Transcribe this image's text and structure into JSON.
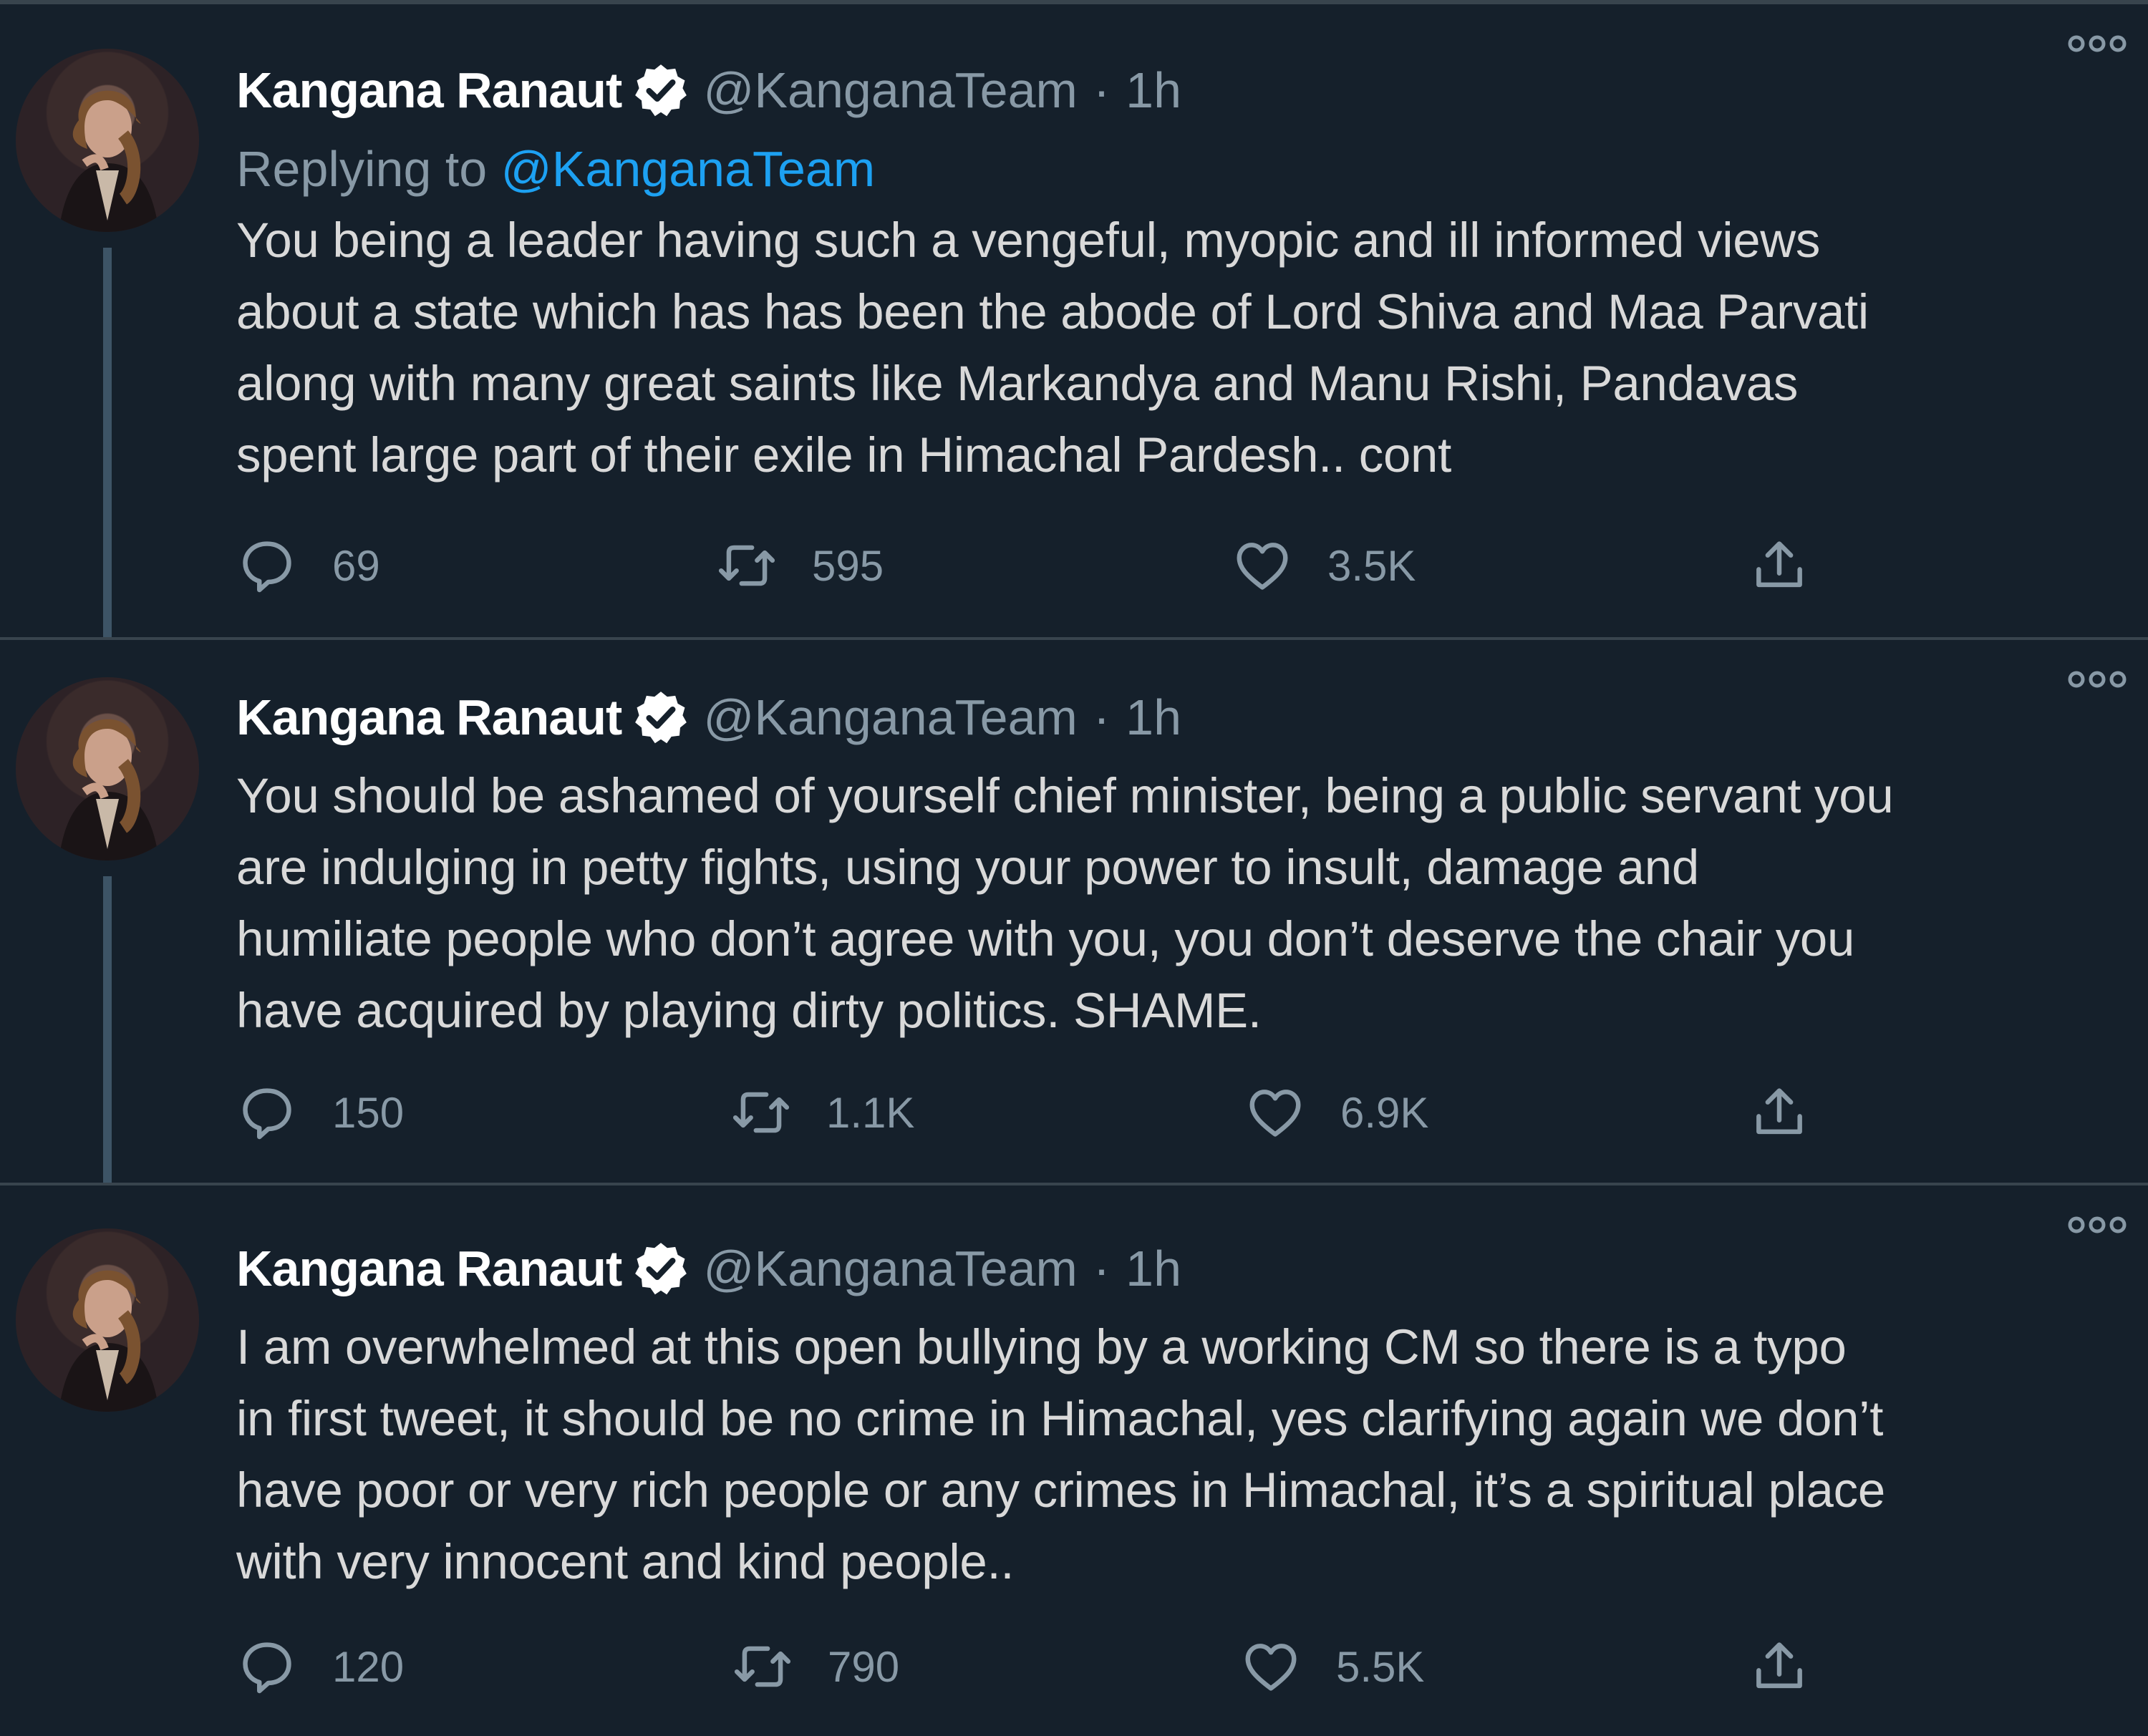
{
  "colors": {
    "background": "#15202b",
    "divider": "#38444d",
    "name": "#ffffff",
    "secondary": "#8899a6",
    "body_text": "#d9d9d9",
    "mention": "#1da1f2",
    "thread_line": "#3d5466"
  },
  "tweets": [
    {
      "name": "Kangana Ranaut",
      "handle": "@KanganaTeam",
      "separator": "·",
      "time": "1h",
      "replying_label": "Replying to",
      "replying_to": "@KanganaTeam",
      "text": "You being a leader having such a vengeful, myopic and ill informed views\nabout a state which has has been the abode of Lord Shiva and Maa Parvati\nalong with many great saints like Markandya and Manu Rishi, Pandavas\nspent large part of their exile in Himachal Pardesh.. cont",
      "replies": "69",
      "retweets": "595",
      "likes": "3.5K"
    },
    {
      "name": "Kangana Ranaut",
      "handle": "@KanganaTeam",
      "separator": "·",
      "time": "1h",
      "text": "You should be ashamed of yourself chief minister, being a public servant you\nare indulging in petty fights, using your power to insult, damage and\nhumiliate people who don’t agree with you, you don’t deserve the chair you\nhave acquired by playing dirty politics. SHAME.",
      "replies": "150",
      "retweets": "1.1K",
      "likes": "6.9K"
    },
    {
      "name": "Kangana Ranaut",
      "handle": "@KanganaTeam",
      "separator": "·",
      "time": "1h",
      "text": "I am overwhelmed at this open bullying by a working CM so there is a typo\nin first tweet, it should be no crime in Himachal, yes clarifying again we don’t\nhave poor or very rich people or any crimes in Himachal, it’s a spiritual place\nwith very innocent and kind people..",
      "replies": "120",
      "retweets": "790",
      "likes": "5.5K"
    }
  ],
  "icons": {
    "verified": "verified-badge-icon",
    "more": "more-options-icon",
    "reply": "reply-bubble-icon",
    "retweet": "retweet-icon",
    "like": "heart-icon",
    "share": "share-upload-icon"
  }
}
